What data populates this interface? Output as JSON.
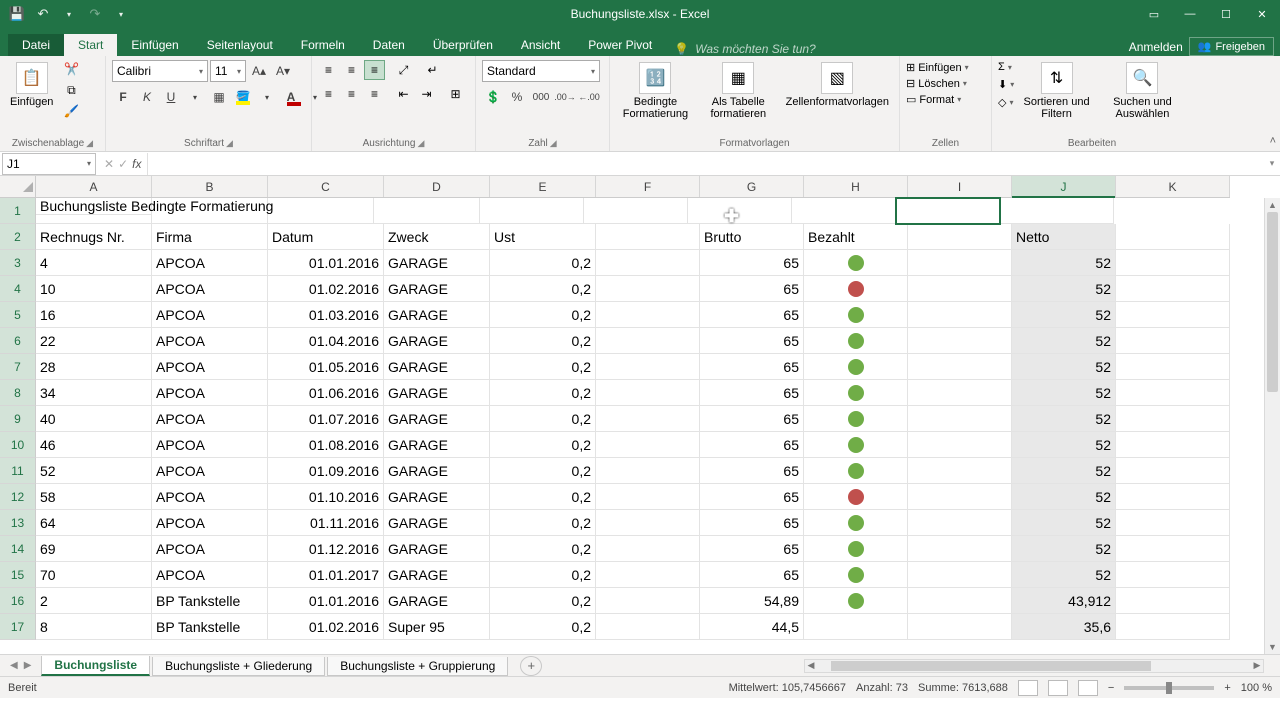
{
  "title": "Buchungsliste.xlsx - Excel",
  "qa": {
    "save": "💾",
    "undo": "↶",
    "redo": "↷",
    "dd": "▾"
  },
  "win": {
    "opts": "▭",
    "min": "—",
    "max": "☐",
    "close": "✕"
  },
  "tabs": {
    "file": "Datei",
    "items": [
      "Start",
      "Einfügen",
      "Seitenlayout",
      "Formeln",
      "Daten",
      "Überprüfen",
      "Ansicht",
      "Power Pivot"
    ],
    "active": "Start",
    "tellme": "Was möchten Sie tun?",
    "signin": "Anmelden",
    "share": "Freigeben"
  },
  "ribbon": {
    "clipboard": {
      "paste": "Einfügen",
      "label": "Zwischenablage"
    },
    "font": {
      "name": "Calibri",
      "size": "11",
      "label": "Schriftart",
      "bold": "F",
      "italic": "K",
      "underline": "U"
    },
    "align": {
      "label": "Ausrichtung",
      "wrap": "⇔"
    },
    "number": {
      "format": "Standard",
      "label": "Zahl"
    },
    "styles": {
      "cond": "Bedingte Formatierung",
      "table": "Als Tabelle formatieren",
      "cell": "Zellenformatvorlagen",
      "label": "Formatvorlagen"
    },
    "cells": {
      "insert": "Einfügen",
      "delete": "Löschen",
      "format": "Format",
      "label": "Zellen"
    },
    "editing": {
      "sort": "Sortieren und Filtern",
      "find": "Suchen und Auswählen",
      "label": "Bearbeiten",
      "sum": "Σ",
      "fill": "⬇",
      "clear": "◇"
    }
  },
  "namebox": "J1",
  "columns": [
    "A",
    "B",
    "C",
    "D",
    "E",
    "F",
    "G",
    "H",
    "I",
    "J",
    "K"
  ],
  "selectedCol": "J",
  "rownums": [
    "1",
    "2",
    "3",
    "4",
    "5",
    "6",
    "7",
    "8",
    "9",
    "10",
    "11",
    "12",
    "13",
    "14",
    "15",
    "16",
    "17"
  ],
  "title_cell": "Buchungsliste Bedingte Formatierung",
  "headers": {
    "A": "Rechnugs Nr.",
    "B": "Firma",
    "C": "Datum",
    "D": "Zweck",
    "E": "Ust",
    "G": "Brutto",
    "H": "Bezahlt",
    "J": "Netto"
  },
  "rows": [
    {
      "A": "4",
      "B": "APCOA",
      "C": "01.01.2016",
      "D": "GARAGE",
      "E": "0,2",
      "G": "65",
      "H": "green",
      "J": "52"
    },
    {
      "A": "10",
      "B": "APCOA",
      "C": "01.02.2016",
      "D": "GARAGE",
      "E": "0,2",
      "G": "65",
      "H": "red",
      "J": "52"
    },
    {
      "A": "16",
      "B": "APCOA",
      "C": "01.03.2016",
      "D": "GARAGE",
      "E": "0,2",
      "G": "65",
      "H": "green",
      "J": "52"
    },
    {
      "A": "22",
      "B": "APCOA",
      "C": "01.04.2016",
      "D": "GARAGE",
      "E": "0,2",
      "G": "65",
      "H": "green",
      "J": "52"
    },
    {
      "A": "28",
      "B": "APCOA",
      "C": "01.05.2016",
      "D": "GARAGE",
      "E": "0,2",
      "G": "65",
      "H": "green",
      "J": "52"
    },
    {
      "A": "34",
      "B": "APCOA",
      "C": "01.06.2016",
      "D": "GARAGE",
      "E": "0,2",
      "G": "65",
      "H": "green",
      "J": "52"
    },
    {
      "A": "40",
      "B": "APCOA",
      "C": "01.07.2016",
      "D": "GARAGE",
      "E": "0,2",
      "G": "65",
      "H": "green",
      "J": "52"
    },
    {
      "A": "46",
      "B": "APCOA",
      "C": "01.08.2016",
      "D": "GARAGE",
      "E": "0,2",
      "G": "65",
      "H": "green",
      "J": "52"
    },
    {
      "A": "52",
      "B": "APCOA",
      "C": "01.09.2016",
      "D": "GARAGE",
      "E": "0,2",
      "G": "65",
      "H": "green",
      "J": "52"
    },
    {
      "A": "58",
      "B": "APCOA",
      "C": "01.10.2016",
      "D": "GARAGE",
      "E": "0,2",
      "G": "65",
      "H": "red",
      "J": "52"
    },
    {
      "A": "64",
      "B": "APCOA",
      "C": "01.11.2016",
      "D": "GARAGE",
      "E": "0,2",
      "G": "65",
      "H": "green",
      "J": "52"
    },
    {
      "A": "69",
      "B": "APCOA",
      "C": "01.12.2016",
      "D": "GARAGE",
      "E": "0,2",
      "G": "65",
      "H": "green",
      "J": "52"
    },
    {
      "A": "70",
      "B": "APCOA",
      "C": "01.01.2017",
      "D": "GARAGE",
      "E": "0,2",
      "G": "65",
      "H": "green",
      "J": "52"
    },
    {
      "A": "2",
      "B": "BP Tankstelle",
      "C": "01.01.2016",
      "D": "GARAGE",
      "E": "0,2",
      "G": "54,89",
      "H": "green",
      "J": "43,912"
    },
    {
      "A": "8",
      "B": "BP Tankstelle",
      "C": "01.02.2016",
      "D": "Super 95",
      "E": "0,2",
      "G": "44,5",
      "H": "",
      "J": "35,6"
    }
  ],
  "sheets": {
    "items": [
      "Buchungsliste",
      "Buchungsliste + Gliederung",
      "Buchungsliste + Gruppierung"
    ],
    "active": "Buchungsliste"
  },
  "status": {
    "ready": "Bereit",
    "avg_label": "Mittelwert:",
    "avg": "105,7456667",
    "count_label": "Anzahl:",
    "count": "73",
    "sum_label": "Summe:",
    "sum": "7613,688",
    "zoom": "100 %",
    "minus": "−",
    "plus": "+"
  }
}
